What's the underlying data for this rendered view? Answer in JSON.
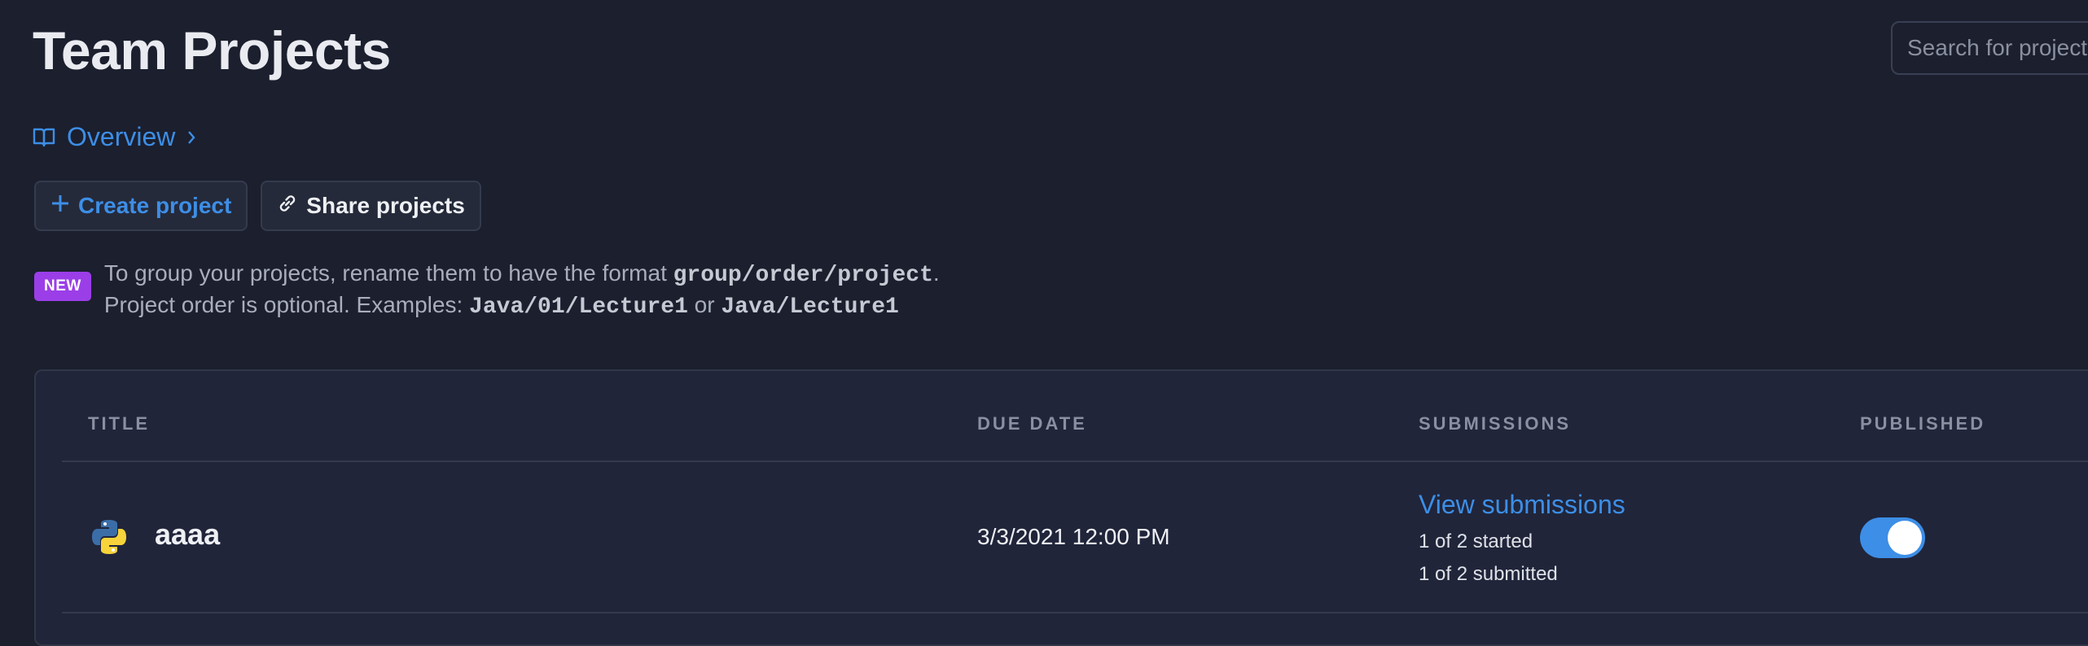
{
  "header": {
    "title": "Team Projects",
    "search_placeholder": "Search for projects"
  },
  "breadcrumb": {
    "label": "Overview",
    "icon": "book-icon"
  },
  "actions": {
    "create_label": "Create project",
    "share_label": "Share projects"
  },
  "notice": {
    "badge": "NEW",
    "line1_prefix": "To group your projects, rename them to have the format ",
    "line1_code": "group/order/project",
    "line1_suffix": ".",
    "line2_prefix": "Project order is optional. Examples: ",
    "example1": "Java/01/Lecture1",
    "line2_mid": " or ",
    "example2": "Java/Lecture1"
  },
  "table": {
    "columns": [
      "TITLE",
      "DUE DATE",
      "SUBMISSIONS",
      "PUBLISHED"
    ],
    "rows": [
      {
        "language_icon": "python-icon",
        "title": "aaaa",
        "due_date": "3/3/2021 12:00 PM",
        "submissions_link": "View submissions",
        "started": "1 of 2 started",
        "submitted": "1 of 2 submitted",
        "published": true
      }
    ]
  },
  "colors": {
    "background": "#1b1f2e",
    "accent": "#3d8ee6",
    "badge": "#9b3ee8"
  }
}
